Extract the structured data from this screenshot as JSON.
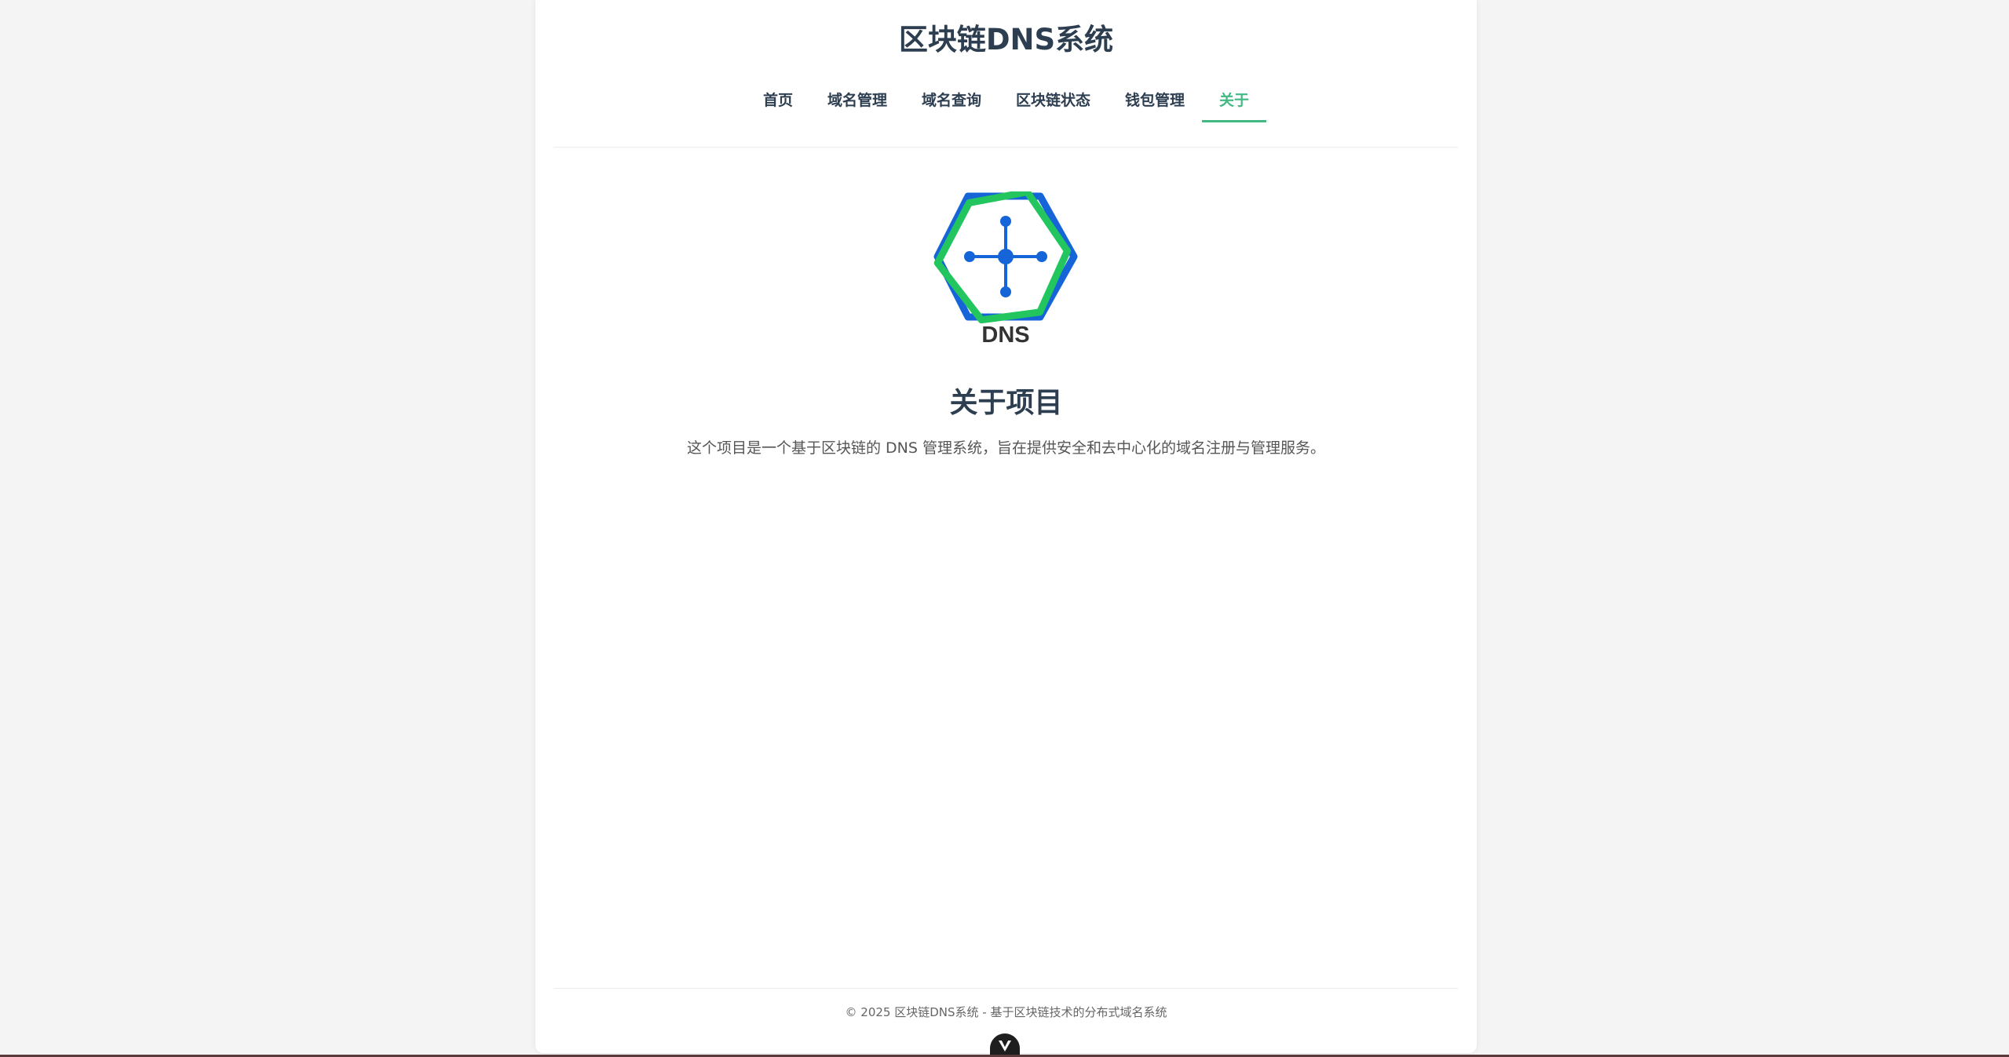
{
  "header": {
    "site_title": "区块链DNS系统"
  },
  "nav": {
    "items": [
      {
        "label": "首页",
        "active": false
      },
      {
        "label": "域名管理",
        "active": false
      },
      {
        "label": "域名查询",
        "active": false
      },
      {
        "label": "区块链状态",
        "active": false
      },
      {
        "label": "钱包管理",
        "active": false
      },
      {
        "label": "关于",
        "active": true
      }
    ]
  },
  "logo": {
    "text": "DNS",
    "icon": "blockchain-dns-hexagon-logo",
    "colors": {
      "blue": "#1565d8",
      "green": "#22c55e",
      "text": "#333333"
    }
  },
  "main": {
    "heading": "关于项目",
    "description": "这个项目是一个基于区块链的 DNS 管理系统，旨在提供安全和去中心化的域名注册与管理服务。"
  },
  "footer": {
    "text": "© 2025 区块链DNS系统 - 基于区块链技术的分布式域名系统"
  },
  "theme": {
    "accent": "#42b983",
    "text": "#2c3e50",
    "background": "#f4f4f4"
  },
  "devtools": {
    "icon": "vue-devtools-icon"
  }
}
